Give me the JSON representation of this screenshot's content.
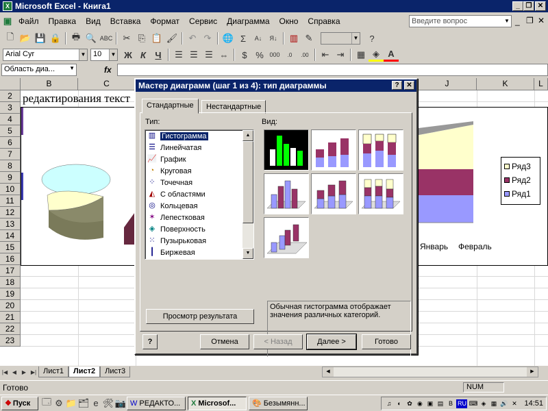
{
  "window": {
    "title": "Microsoft Excel - Книга1"
  },
  "menu": {
    "items": [
      "Файл",
      "Правка",
      "Вид",
      "Вставка",
      "Формат",
      "Сервис",
      "Диаграмма",
      "Окно",
      "Справка"
    ],
    "ask_placeholder": "Введите вопрос"
  },
  "format_toolbar": {
    "font": "Arial Cyr",
    "size": "10",
    "bold": "Ж",
    "italic": "К",
    "underline": "Ч"
  },
  "formula_bar": {
    "name_box": "Область диа...",
    "fx": "fx"
  },
  "sheet": {
    "columns": [
      "B",
      "C",
      "J",
      "K",
      "L"
    ],
    "rows": [
      "2",
      "3",
      "4",
      "5",
      "6",
      "7",
      "8",
      "9",
      "10",
      "11",
      "12",
      "13",
      "14",
      "15",
      "16",
      "17",
      "18",
      "19",
      "20",
      "21",
      "22",
      "23"
    ],
    "cell_text": "редактирования текст",
    "tabs": [
      "Лист1",
      "Лист2",
      "Лист3"
    ],
    "active_tab": "Лист2"
  },
  "bg_chart": {
    "legend": [
      "Ряд3",
      "Ряд2",
      "Ряд1"
    ],
    "xlabels": [
      "Январь",
      "Февраль"
    ],
    "colors": {
      "ryad1": "#9999ff",
      "ryad2": "#993366",
      "ryad3": "#ffffcc"
    }
  },
  "status": {
    "left": "Готово",
    "num": "NUM"
  },
  "dialog": {
    "title": "Мастер диаграмм (шаг 1 из 4): тип диаграммы",
    "help": "?",
    "close": "✕",
    "tabs": [
      "Стандартные",
      "Нестандартные"
    ],
    "type_label": "Тип:",
    "view_label": "Вид:",
    "types": [
      {
        "label": "Гистограмма",
        "icon": "column-chart-icon"
      },
      {
        "label": "Линейчатая",
        "icon": "bar-chart-icon"
      },
      {
        "label": "График",
        "icon": "line-chart-icon"
      },
      {
        "label": "Круговая",
        "icon": "pie-chart-icon"
      },
      {
        "label": "Точечная",
        "icon": "scatter-chart-icon"
      },
      {
        "label": "С областями",
        "icon": "area-chart-icon"
      },
      {
        "label": "Кольцевая",
        "icon": "doughnut-chart-icon"
      },
      {
        "label": "Лепестковая",
        "icon": "radar-chart-icon"
      },
      {
        "label": "Поверхность",
        "icon": "surface-chart-icon"
      },
      {
        "label": "Пузырьковая",
        "icon": "bubble-chart-icon"
      },
      {
        "label": "Биржевая",
        "icon": "stock-chart-icon"
      }
    ],
    "selected_type": "Гистограмма",
    "description": "Обычная гистограмма отображает значения различных категорий.",
    "preview_button": "Просмотр результата",
    "buttons": {
      "help": "?",
      "cancel": "Отмена",
      "back": "< Назад",
      "next": "Далее >",
      "finish": "Готово"
    }
  },
  "taskbar": {
    "start": "Пуск",
    "tasks": [
      "РЕДАКТО...",
      "Microsof...",
      "Безымянн..."
    ],
    "active_task": "Microsof...",
    "lang": "RU",
    "time": "14:51"
  }
}
